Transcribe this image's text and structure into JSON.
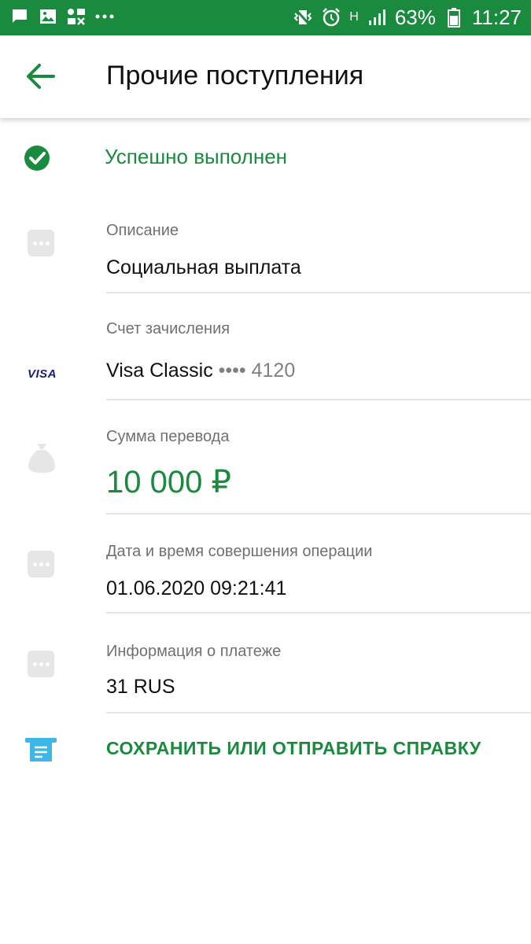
{
  "status_bar": {
    "battery": "63%",
    "time": "11:27",
    "network_letter": "H",
    "icons": [
      "chat-icon",
      "image-icon",
      "apps-icon",
      "more-dots-icon",
      "vibrate-icon",
      "alarm-icon",
      "signal-icon",
      "battery-icon"
    ]
  },
  "header": {
    "title": "Прочие поступления",
    "back_icon": "arrow-left-icon"
  },
  "status": {
    "text": "Успешно выполнен",
    "icon": "check-circle-icon"
  },
  "fields": {
    "description": {
      "label": "Описание",
      "value": "Социальная выплата"
    },
    "account": {
      "label": "Счет зачисления",
      "card_name": "Visa Classic",
      "card_mask": "•••• 4120",
      "brand": "VISA"
    },
    "amount": {
      "label": "Сумма перевода",
      "value": "10 000 ₽"
    },
    "datetime": {
      "label": "Дата и время совершения операции",
      "value": "01.06.2020 09:21:41"
    },
    "info": {
      "label": "Информация о платеже",
      "value": "31 RUS"
    }
  },
  "action": {
    "label": "СОХРАНИТЬ ИЛИ ОТПРАВИТЬ СПРАВКУ",
    "icon": "receipt-icon"
  },
  "colors": {
    "accent": "#1a8a3e",
    "status_bar": "#1a8a3e",
    "receipt_icon": "#3db7e8",
    "muted_icon": "#e6e6e6"
  }
}
